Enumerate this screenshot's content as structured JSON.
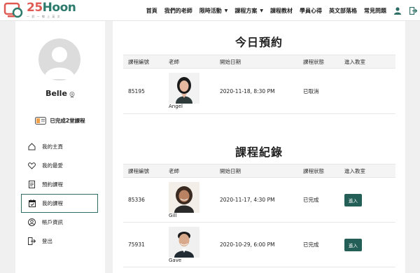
{
  "brand": {
    "number": "25",
    "word": "Hoon",
    "tagline": "一 對 一 線 上 英 文"
  },
  "nav": {
    "items": [
      {
        "label": "首頁",
        "dropdown": false
      },
      {
        "label": "我們的老師",
        "dropdown": false
      },
      {
        "label": "限時活動",
        "dropdown": true
      },
      {
        "label": "課程方案",
        "dropdown": true
      },
      {
        "label": "課程教材",
        "dropdown": false
      },
      {
        "label": "學員心得",
        "dropdown": false
      },
      {
        "label": "英文部落格",
        "dropdown": false
      },
      {
        "label": "常見問題",
        "dropdown": false
      }
    ],
    "icons": [
      "user-icon",
      "logout-icon"
    ]
  },
  "profile": {
    "name": "Belle",
    "completed": "已完成2堂課程"
  },
  "menu": [
    {
      "label": "我的主頁",
      "icon": "home-icon",
      "active": false
    },
    {
      "label": "我的最愛",
      "icon": "heart-icon",
      "active": false
    },
    {
      "label": "預約課程",
      "icon": "document-icon",
      "active": false
    },
    {
      "label": "我的課程",
      "icon": "calendar-icon",
      "active": true
    },
    {
      "label": "帳戶資訊",
      "icon": "account-icon",
      "active": false
    },
    {
      "label": "登出",
      "icon": "logout-icon",
      "active": false
    }
  ],
  "today": {
    "title": "今日預約",
    "headers": [
      "課程編號",
      "老師",
      "開始日期",
      "課程狀態",
      "進入教室"
    ],
    "rows": [
      {
        "id": "85195",
        "teacher": "Angel",
        "date": "2020-11-18, 8:30 PM",
        "status": "已取消",
        "enter": ""
      }
    ]
  },
  "history": {
    "title": "課程紀錄",
    "headers": [
      "課程編號",
      "老師",
      "開始日期",
      "課程狀態",
      "進入教室"
    ],
    "rows": [
      {
        "id": "85336",
        "teacher": "Gill",
        "date": "2020-11-17, 4:30 PM",
        "status": "已完成",
        "enter": "進入"
      },
      {
        "id": "75931",
        "teacher": "Gave",
        "date": "2020-10-29, 6:00 PM",
        "status": "已完成",
        "enter": "進入"
      }
    ]
  },
  "colors": {
    "brand_red": "#e05a54",
    "brand_green": "#2c7a6c",
    "button": "#235f57"
  }
}
